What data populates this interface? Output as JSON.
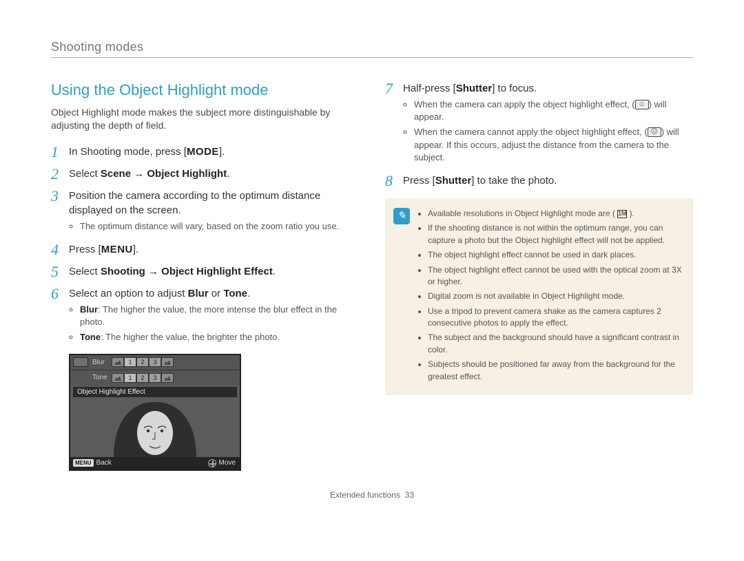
{
  "chapter": "Shooting modes",
  "section_title": "Using the Object Highlight mode",
  "intro": "Object Highlight mode makes the subject more distinguishable by adjusting the depth of field.",
  "left_steps": [
    {
      "num": "1",
      "text_pre": "In Shooting mode, press [",
      "btn": "MODE",
      "text_post": "]."
    },
    {
      "num": "2",
      "text_pre": "Select ",
      "bold": "Scene → Object Highlight",
      "text_post": "."
    },
    {
      "num": "3",
      "text": "Position the camera according to the optimum distance displayed on the screen.",
      "sub_bullets": [
        "The optimum distance will vary, based on the zoom ratio you use."
      ]
    },
    {
      "num": "4",
      "text_pre": "Press [",
      "btn": "MENU",
      "text_post": "]."
    },
    {
      "num": "5",
      "text_pre": "Select ",
      "bold": "Shooting → Object Highlight Effect",
      "text_post": "."
    },
    {
      "num": "6",
      "text_pre": "Select an option to adjust ",
      "bold": "Blur",
      "mid": " or ",
      "bold2": "Tone",
      "text_post": ".",
      "sub_def": [
        {
          "term": "Blur",
          "def": ": The higher the value, the more intense the blur effect in the photo."
        },
        {
          "term": "Tone",
          "def": ": The higher the value, the brighter the photo."
        }
      ]
    }
  ],
  "camera_ui": {
    "row1_label": "Blur",
    "row2_label": "Tone",
    "ticks": [
      "1",
      "2",
      "3"
    ],
    "overlay": "Object Highlight Effect",
    "back": "Back",
    "back_btn": "MENU",
    "move": "Move"
  },
  "right_steps": [
    {
      "num": "7",
      "text_pre": "Half-press [",
      "bold": "Shutter",
      "text_post": "] to focus.",
      "sub_bullets_icon": [
        {
          "pre": "When the camera can apply the object highlight effect, (",
          "icon": "highlight-ok-icon",
          "post": ") will appear."
        },
        {
          "pre": "When the camera cannot apply the object highlight effect, (",
          "icon": "highlight-fail-icon",
          "post": ") will appear. If this occurs, adjust the distance from the camera to the subject."
        }
      ]
    },
    {
      "num": "8",
      "text_pre": "Press [",
      "bold": "Shutter",
      "text_post": "] to take the photo."
    }
  ],
  "notes": [
    "Available resolutions in Object Highlight mode are ( 1M ).",
    "If the shooting distance is not within the optimum range, you can capture a photo but the Object highlight effect will not be applied.",
    "The object highlight effect cannot be used in dark places.",
    "The object highlight effect cannot be used with the optical zoom at 3X or higher.",
    "Digital zoom is not available in Object Highlight mode.",
    "Use a tripod to prevent camera shake as the camera captures 2 consecutive photos to apply the effect.",
    "The subject and the background should have a significant contrast in color.",
    "Subjects should be positioned far away from the background for the greatest effect."
  ],
  "notes_icon_label": "i",
  "footer_label": "Extended functions",
  "footer_page": "33"
}
